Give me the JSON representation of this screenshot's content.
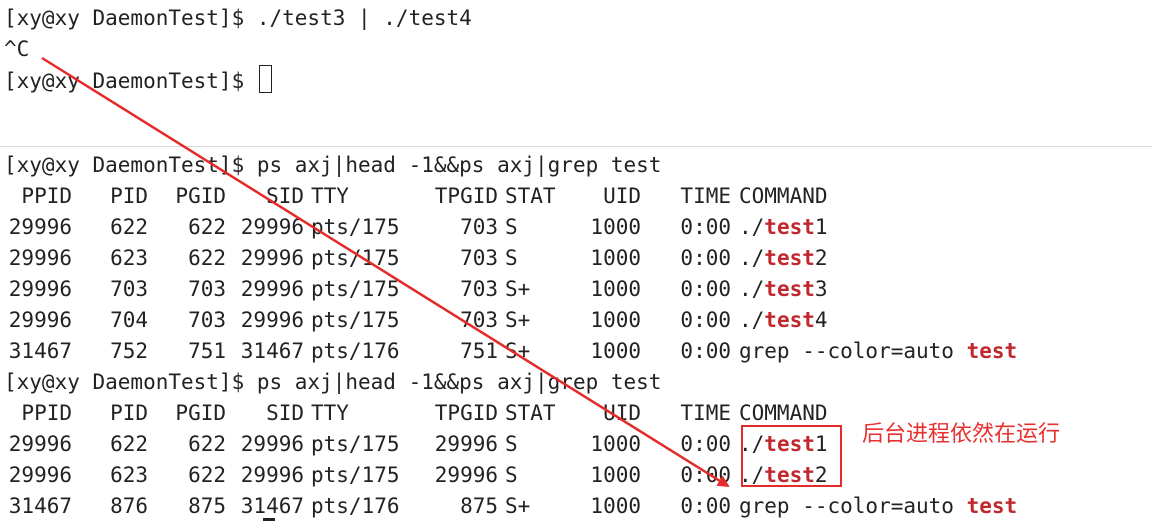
{
  "terminal_top": {
    "lines": [
      "[xy@xy DaemonTest]$ ./test3 | ./test4",
      "^C",
      "[xy@xy DaemonTest]$ "
    ]
  },
  "terminal_bottom": {
    "prompt1": "[xy@xy DaemonTest]$ ps axj|head -1&&ps axj|grep test",
    "header": [
      "PPID",
      "PID",
      "PGID",
      "SID",
      "TTY",
      "TPGID",
      "STAT",
      "UID",
      "TIME",
      "COMMAND"
    ],
    "rows1": [
      {
        "ppid": "29996",
        "pid": "622",
        "pgid": "622",
        "sid": "29996",
        "tty": "pts/175",
        "tpgid": "703",
        "stat": "S",
        "uid": "1000",
        "time": "0:00",
        "cmd_prefix": "./",
        "cmd_hl": "test",
        "cmd_suffix": "1"
      },
      {
        "ppid": "29996",
        "pid": "623",
        "pgid": "622",
        "sid": "29996",
        "tty": "pts/175",
        "tpgid": "703",
        "stat": "S",
        "uid": "1000",
        "time": "0:00",
        "cmd_prefix": "./",
        "cmd_hl": "test",
        "cmd_suffix": "2"
      },
      {
        "ppid": "29996",
        "pid": "703",
        "pgid": "703",
        "sid": "29996",
        "tty": "pts/175",
        "tpgid": "703",
        "stat": "S+",
        "uid": "1000",
        "time": "0:00",
        "cmd_prefix": "./",
        "cmd_hl": "test",
        "cmd_suffix": "3"
      },
      {
        "ppid": "29996",
        "pid": "704",
        "pgid": "703",
        "sid": "29996",
        "tty": "pts/175",
        "tpgid": "703",
        "stat": "S+",
        "uid": "1000",
        "time": "0:00",
        "cmd_prefix": "./",
        "cmd_hl": "test",
        "cmd_suffix": "4"
      },
      {
        "ppid": "31467",
        "pid": "752",
        "pgid": "751",
        "sid": "31467",
        "tty": "pts/176",
        "tpgid": "751",
        "stat": "S+",
        "uid": "1000",
        "time": "0:00",
        "cmd_prefix": "grep --color=auto ",
        "cmd_hl": "test",
        "cmd_suffix": ""
      }
    ],
    "prompt2": "[xy@xy DaemonTest]$ ps axj|head -1&&ps axj|grep test",
    "rows2": [
      {
        "ppid": "29996",
        "pid": "622",
        "pgid": "622",
        "sid": "29996",
        "tty": "pts/175",
        "tpgid": "29996",
        "stat": "S",
        "uid": "1000",
        "time": "0:00",
        "cmd_prefix": "./",
        "cmd_hl": "test",
        "cmd_suffix": "1"
      },
      {
        "ppid": "29996",
        "pid": "623",
        "pgid": "622",
        "sid": "29996",
        "tty": "pts/175",
        "tpgid": "29996",
        "stat": "S",
        "uid": "1000",
        "time": "0:00",
        "cmd_prefix": "./",
        "cmd_hl": "test",
        "cmd_suffix": "2"
      },
      {
        "ppid": "31467",
        "pid": "876",
        "pgid": "875",
        "sid": "31467",
        "tty": "pts/176",
        "tpgid": "875",
        "stat": "S+",
        "uid": "1000",
        "time": "0:00",
        "cmd_prefix": "grep --color=auto ",
        "cmd_hl": "test",
        "cmd_suffix": ""
      }
    ]
  },
  "annotation": {
    "text": "后台进程依然在运行",
    "color": "#e52a2a"
  },
  "colors": {
    "highlight": "#c0282d",
    "arrow": "#e52a2a"
  }
}
